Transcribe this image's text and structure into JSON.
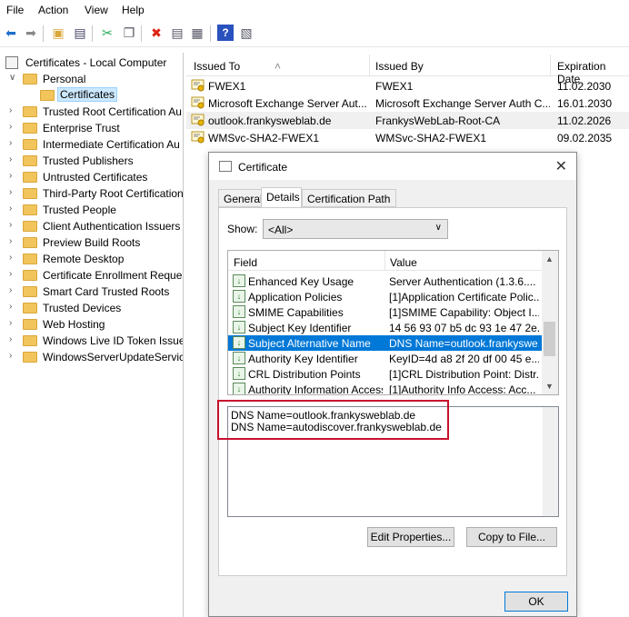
{
  "menu": [
    "File",
    "Action",
    "View",
    "Help"
  ],
  "toolbar": {
    "icons": [
      "back-arrow-icon",
      "forward-arrow-icon",
      "up-folder-icon",
      "show-hide-tree-icon",
      "cut-icon",
      "copy-icon",
      "delete-icon",
      "properties-icon",
      "export-icon",
      "help-icon",
      "snapin-icon"
    ]
  },
  "tree": {
    "root": "Certificates - Local Computer",
    "personal": "Personal",
    "certificates": "Certificates",
    "items": [
      "Trusted Root Certification Au",
      "Enterprise Trust",
      "Intermediate Certification Au",
      "Trusted Publishers",
      "Untrusted Certificates",
      "Third-Party Root Certification",
      "Trusted People",
      "Client Authentication Issuers",
      "Preview Build Roots",
      "Remote Desktop",
      "Certificate Enrollment Reques",
      "Smart Card Trusted Roots",
      "Trusted Devices",
      "Web Hosting",
      "Windows Live ID Token Issuer",
      "WindowsServerUpdateService"
    ]
  },
  "list": {
    "columns": [
      "Issued To",
      "Issued By",
      "Expiration Date"
    ],
    "rows": [
      {
        "to": "FWEX1",
        "by": "FWEX1",
        "exp": "11.02.2030"
      },
      {
        "to": "Microsoft Exchange Server Aut...",
        "by": "Microsoft Exchange Server Auth C...",
        "exp": "16.01.2030"
      },
      {
        "to": "outlook.frankysweblab.de",
        "by": "FrankysWebLab-Root-CA",
        "exp": "11.02.2026"
      },
      {
        "to": "WMSvc-SHA2-FWEX1",
        "by": "WMSvc-SHA2-FWEX1",
        "exp": "09.02.2035"
      }
    ]
  },
  "dialog": {
    "title": "Certificate",
    "tabs": [
      "General",
      "Details",
      "Certification Path"
    ],
    "show_label": "Show:",
    "show_value": "<All>",
    "field_header": "Field",
    "value_header": "Value",
    "fields": [
      {
        "name": "Enhanced Key Usage",
        "value": "Server Authentication (1.3.6...."
      },
      {
        "name": "Application Policies",
        "value": "[1]Application Certificate Polic..."
      },
      {
        "name": "SMIME Capabilities",
        "value": "[1]SMIME Capability: Object I..."
      },
      {
        "name": "Subject Key Identifier",
        "value": "14 56 93 07 b5 dc 93 1e 47 2e..."
      },
      {
        "name": "Subject Alternative Name",
        "value": "DNS Name=outlook.frankyswe..."
      },
      {
        "name": "Authority Key Identifier",
        "value": "KeyID=4d a8 2f 20 df 00 45 e..."
      },
      {
        "name": "CRL Distribution Points",
        "value": "[1]CRL Distribution Point: Distr..."
      },
      {
        "name": "Authority Information Access",
        "value": "[1]Authority Info Access: Acc..."
      }
    ],
    "detail_lines": [
      "DNS Name=outlook.frankysweblab.de",
      "DNS Name=autodiscover.frankysweblab.de"
    ],
    "edit_button": "Edit Properties...",
    "copy_button": "Copy to File...",
    "ok_button": "OK"
  },
  "colors": {
    "highlight_box": "#c8102e",
    "selection": "#0078d7"
  }
}
